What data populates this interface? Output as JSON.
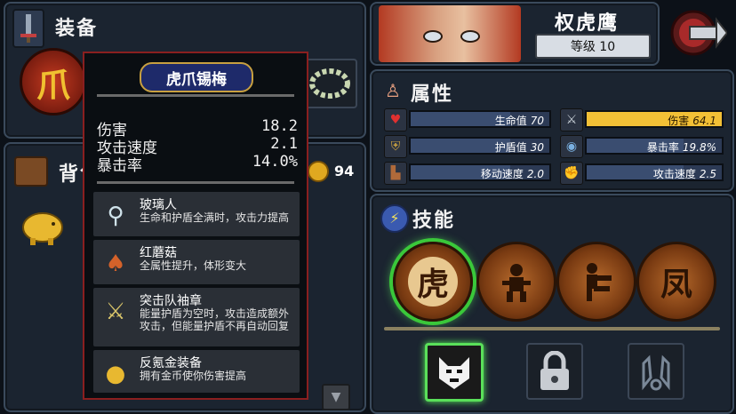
{
  "equipment": {
    "title": "装备"
  },
  "backpack": {
    "title": "背包",
    "gold": "94"
  },
  "character": {
    "name": "权虎鹰",
    "level_label": "等级 10"
  },
  "attributes": {
    "title": "属性",
    "items": [
      {
        "label": "生命值",
        "value": "70",
        "fill": 0.72,
        "icon": "heart-icon"
      },
      {
        "label": "伤害",
        "value": "64.1",
        "fill": 1.0,
        "icon": "sword-icon",
        "highlight": true
      },
      {
        "label": "护盾值",
        "value": "30",
        "fill": 0.72,
        "icon": "shield-icon"
      },
      {
        "label": "暴击率",
        "value": "19.8%",
        "fill": 0.72,
        "icon": "eye-icon"
      },
      {
        "label": "移动速度",
        "value": "2.0",
        "fill": 0.72,
        "icon": "boot-icon"
      },
      {
        "label": "攻击速度",
        "value": "2.5",
        "fill": 0.72,
        "icon": "fist-icon"
      }
    ]
  },
  "skills": {
    "title": "技能",
    "glyphs": [
      "虎",
      "",
      "",
      "凤"
    ]
  },
  "tooltip": {
    "item_name": "虎爪锡梅",
    "stats": [
      {
        "label": "伤害",
        "value": "18.2"
      },
      {
        "label": "攻击速度",
        "value": "2.1"
      },
      {
        "label": "暴击率",
        "value": "14.0%"
      }
    ],
    "passives": [
      {
        "name": "玻璃人",
        "desc": "生命和护盾全满时，攻击力提高"
      },
      {
        "name": "红蘑菇",
        "desc": "全属性提升，体形变大"
      },
      {
        "name": "突击队袖章",
        "desc": "能量护盾为空时，攻击造成额外攻击，但能量护盾不再自动回复"
      },
      {
        "name": "反氪金装备",
        "desc": "拥有金币使你伤害提高"
      }
    ]
  },
  "colors": {
    "accent": "#f0c030",
    "tooltip_border": "#8a1f1f",
    "panel": "#1b2430",
    "highlight_bar": "#f2c036"
  }
}
